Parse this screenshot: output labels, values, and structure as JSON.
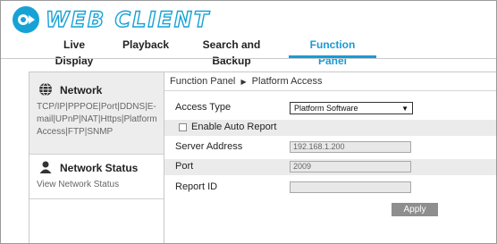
{
  "app": {
    "logo_text": "WEB CLIENT"
  },
  "nav": {
    "tabs": [
      {
        "label": "Live Display"
      },
      {
        "label": "Playback"
      },
      {
        "label": "Search and Backup"
      },
      {
        "label": "Function Panel",
        "active": true
      }
    ]
  },
  "sidebar": {
    "items": [
      {
        "title": "Network",
        "subtitle": "TCP/IP|PPPOE|Port|DDNS|E-mail|UPnP|NAT|Https|Platform Access|FTP|SNMP",
        "icon": "globe-icon"
      },
      {
        "title": "Network Status",
        "subtitle": "View Network Status",
        "icon": "person-icon"
      }
    ]
  },
  "breadcrumb": {
    "parent": "Function Panel",
    "separator": "▶",
    "current": "Platform Access"
  },
  "form": {
    "access_type": {
      "label": "Access Type",
      "value": "Platform Software"
    },
    "auto_report": {
      "label": "Enable Auto Report",
      "checked": false
    },
    "server_address": {
      "label": "Server Address",
      "value": "192.168.1.200"
    },
    "port": {
      "label": "Port",
      "value": "2009"
    },
    "report_id": {
      "label": "Report ID",
      "value": ""
    },
    "apply_label": "Apply"
  },
  "colors": {
    "accent": "#1a9ad6",
    "button": "#8e8e8e"
  }
}
